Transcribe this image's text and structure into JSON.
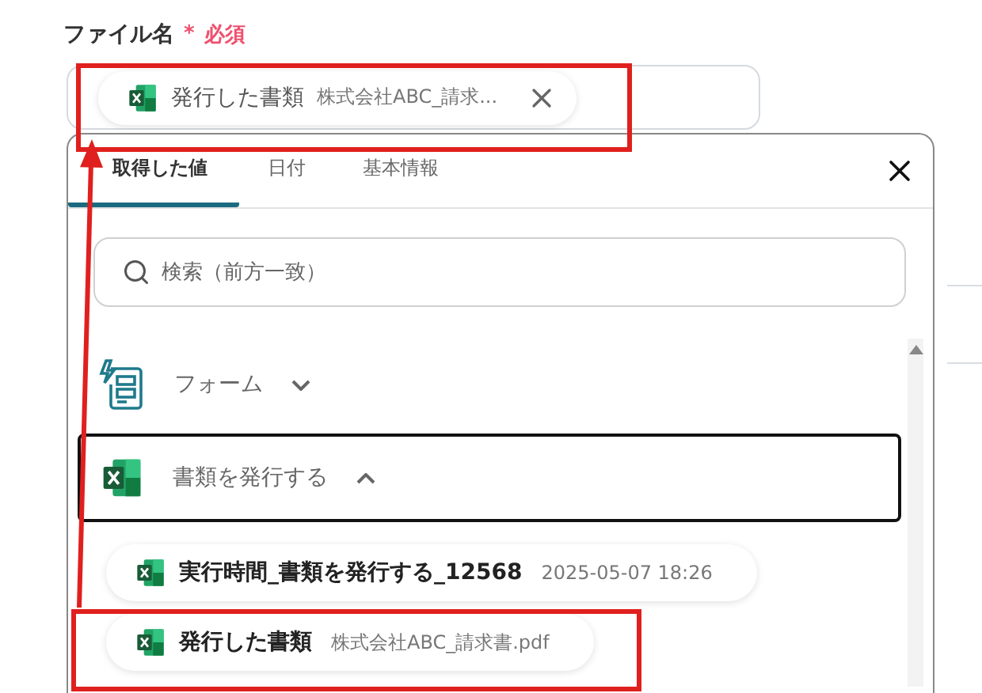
{
  "field": {
    "label": "ファイル名",
    "required_mark": "*",
    "required_text": "必須",
    "chip": {
      "name": "発行した書類",
      "value": "株式会社ABC_請求..."
    }
  },
  "panel": {
    "tabs": [
      {
        "label": "取得した値",
        "selected": true
      },
      {
        "label": "日付",
        "selected": false
      },
      {
        "label": "基本情報",
        "selected": false
      }
    ],
    "search": {
      "placeholder": "検索（前方一致）"
    },
    "groups": [
      {
        "name": "フォーム",
        "kind": "form",
        "expanded": false,
        "selected": false
      },
      {
        "name": "書類を発行する",
        "kind": "spreadsheet",
        "expanded": true,
        "selected": true,
        "items": [
          {
            "name": "実行時間_書類を発行する_12568",
            "value": "2025-05-07 18:26"
          },
          {
            "name": "発行した書類",
            "value": "株式会社ABC_請求書.pdf"
          }
        ]
      }
    ]
  }
}
